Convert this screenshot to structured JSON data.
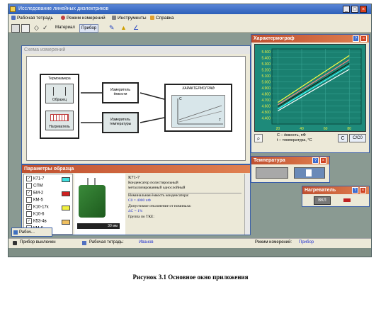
{
  "window": {
    "title": "Исследование линейных диэлектриков",
    "buttons": [
      "_",
      "□",
      "×"
    ]
  },
  "menu": [
    {
      "label": "Рабочая тетрадь",
      "icon": "notebook-icon"
    },
    {
      "label": "Режим измерений",
      "icon": "measure-mode-icon"
    },
    {
      "label": "Инструменты",
      "icon": "tools-icon"
    },
    {
      "label": "Справка",
      "icon": "help-book-icon"
    }
  ],
  "toolbar": {
    "material": "Материал",
    "device": "Прибор"
  },
  "scheme": {
    "title": "Схема измерений",
    "thermo_chamber": "Термокамера",
    "sample": "Образец",
    "heater": "Нагреватель",
    "cap_meter": "Измеритель ёмкости",
    "temp_meter": "Измеритель температуры",
    "char_title": "ХАРАКТЕРИОГРАФ",
    "axis_c": "C",
    "axis_t": "T"
  },
  "char": {
    "title": "Характериограф",
    "legend_c": "C – ёмкость, пФ",
    "legend_t": "t – температура, °С",
    "btn_c": "C",
    "btn_cc0": "C/C0"
  },
  "chart_data": {
    "type": "line",
    "title": "Характериограф",
    "xlabel": "t – температура, °С",
    "ylabel": "C – ёмкость, пФ",
    "x": [
      20,
      40,
      60,
      80
    ],
    "xlim": [
      15,
      90
    ],
    "ylim": [
      4.3,
      5.55
    ],
    "y_ticks": [
      "5.500",
      "5.400",
      "5.300",
      "5.200",
      "5.100",
      "5.000",
      "4.900",
      "4.800",
      "4.700",
      "4.600",
      "4.500",
      "4.400"
    ],
    "x_ticks": [
      "20",
      "40",
      "60",
      "80"
    ],
    "grid": true,
    "series": [
      {
        "color": "#ffff40",
        "values": [
          4.66,
          4.92,
          5.18,
          5.44
        ]
      },
      {
        "color": "#ff8080",
        "values": [
          4.62,
          4.87,
          5.12,
          5.37
        ]
      },
      {
        "color": "#102010",
        "values": [
          4.59,
          4.83,
          5.07,
          5.31
        ]
      },
      {
        "color": "#40ffff",
        "values": [
          4.55,
          4.79,
          5.03,
          5.27
        ]
      },
      {
        "color": "#ffffff",
        "values": [
          4.52,
          4.75,
          4.98,
          5.21
        ]
      }
    ]
  },
  "params": {
    "title": "Параметры образца",
    "items": [
      {
        "label": "К71-7",
        "checked": true,
        "color": "#40e0e0"
      },
      {
        "label": "СПМ",
        "checked": false,
        "color": ""
      },
      {
        "label": "БМ-2",
        "checked": true,
        "color": "#d02020"
      },
      {
        "label": "КМ-5",
        "checked": false,
        "color": ""
      },
      {
        "label": "К10-17к",
        "checked": true,
        "color": "#f0f040"
      },
      {
        "label": "К10-6",
        "checked": false,
        "color": ""
      },
      {
        "label": "К53-4в",
        "checked": true,
        "color": "#f0c060"
      },
      {
        "label": "КМ-6",
        "checked": false,
        "color": ""
      }
    ],
    "photo_scale": "30 мм",
    "desc_name": "К71-7",
    "desc_lines": [
      "Конденсатор полистирольный",
      "металлизированный однослойный"
    ],
    "nominal_label": "Номинальная ёмкость конденсатора:",
    "nominal_value": "C0 = 4000 пФ",
    "tolerance_label": "Допустимое отклонение от номинала:",
    "tolerance_value": "ΔC = 1%",
    "tke_label": "Группа по ТКЕ:"
  },
  "temperature": {
    "title": "Температура"
  },
  "heater": {
    "title": "Нагреватель",
    "switch": "ВКЛ"
  },
  "minimized": {
    "label": "Рабоч..."
  },
  "status": {
    "device": "Прибор выключен",
    "notebook_label": "Рабочая тетрадь:",
    "notebook_value": "Иванов",
    "mode_label": "Режим измерений:",
    "mode_value": "Прибор"
  },
  "caption": "Рисунок 3.1  Основное окно приложения"
}
